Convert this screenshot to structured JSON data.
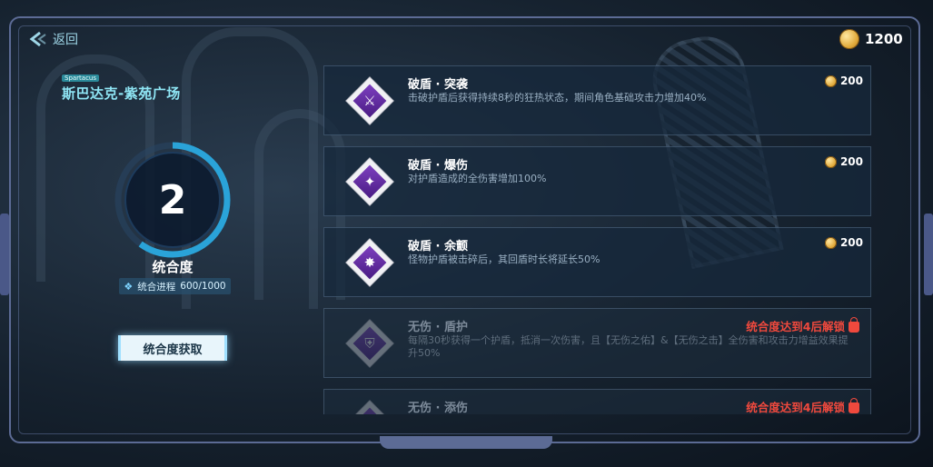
{
  "header": {
    "back_label": "返回",
    "currency": {
      "icon": "coin-icon",
      "amount": "1200"
    }
  },
  "location": {
    "tag": "Spartacus",
    "title": "斯巴达克-紫苑广场"
  },
  "integration": {
    "level": "2",
    "label": "统合度",
    "progress_label": "统合进程",
    "progress_text": "600/1000",
    "progress_fraction": 0.6,
    "acquire_button": "统合度获取"
  },
  "colors": {
    "accent": "#8fe6f5",
    "gauge": "#2aa3d8",
    "locked": "#f0493d",
    "skill": "#6a2fb0"
  },
  "skills": [
    {
      "title": "破盾 · 突袭",
      "desc": "击破护盾后获得持续8秒的狂热状态，期间角色基础攻击力增加40%",
      "cost": "200",
      "locked": false,
      "lock_text": "",
      "icon": "shield-break-icon"
    },
    {
      "title": "破盾 · 爆伤",
      "desc": "对护盾造成的全伤害增加100%",
      "cost": "200",
      "locked": false,
      "lock_text": "",
      "icon": "shield-burst-icon"
    },
    {
      "title": "破盾 · 余颤",
      "desc": "怪物护盾被击碎后，其回盾时长将延长50%",
      "cost": "200",
      "locked": false,
      "lock_text": "",
      "icon": "shield-tremor-icon"
    },
    {
      "title": "无伤 · 盾护",
      "desc": "每隔30秒获得一个护盾，抵消一次伤害，且【无伤之佑】&【无伤之击】全伤害和攻击力增益效果提升50%",
      "cost": "",
      "locked": true,
      "lock_text": "统合度达到4后解锁",
      "icon": "shield-guard-icon"
    },
    {
      "title": "无伤 · 添伤",
      "desc": "",
      "cost": "",
      "locked": true,
      "lock_text": "统合度达到4后解锁",
      "icon": "damage-up-icon"
    }
  ]
}
